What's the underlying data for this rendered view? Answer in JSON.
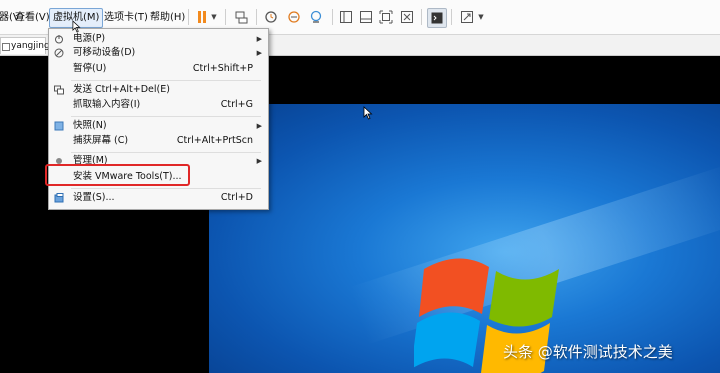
{
  "menubar": {
    "items": [
      {
        "label": "器(V)"
      },
      {
        "label": "查看(V)"
      },
      {
        "label": "虚拟机(M)"
      },
      {
        "label": "选项卡(T)"
      },
      {
        "label": "帮助(H)"
      }
    ]
  },
  "toolbar": {
    "icons": [
      "pause-icon",
      "send-ctrl-alt-del-icon",
      "snapshot-icon",
      "revert-snapshot-icon",
      "snapshot-manager-icon",
      "library-view-icon",
      "thumbnail-view-icon",
      "fit-guest-icon",
      "fullscreen-icon",
      "console-view-icon",
      "stretch-icon"
    ]
  },
  "tabs": [
    {
      "label": "yangjing"
    }
  ],
  "vm_menu": {
    "items": [
      {
        "label": "电源(P)",
        "shortcut": "",
        "submenu": true
      },
      {
        "label": "可移动设备(D)",
        "shortcut": "",
        "submenu": true
      },
      {
        "label": "暂停(U)",
        "shortcut": "Ctrl+Shift+P",
        "submenu": false
      },
      {
        "label": "发送 Ctrl+Alt+Del(E)",
        "shortcut": "",
        "submenu": false
      },
      {
        "label": "抓取输入内容(I)",
        "shortcut": "Ctrl+G",
        "submenu": false
      },
      {
        "label": "快照(N)",
        "shortcut": "",
        "submenu": true
      },
      {
        "label": "捕获屏幕 (C)",
        "shortcut": "Ctrl+Alt+PrtScn",
        "submenu": false
      },
      {
        "label": "管理(M)",
        "shortcut": "",
        "submenu": true
      },
      {
        "label": "安装 VMware Tools(T)...",
        "shortcut": "",
        "submenu": false
      },
      {
        "label": "设置(S)...",
        "shortcut": "Ctrl+D",
        "submenu": false
      }
    ]
  },
  "highlight_color": "#e02727",
  "accent_color": "#f28a1e",
  "watermark": "头条 @软件测试技术之美"
}
